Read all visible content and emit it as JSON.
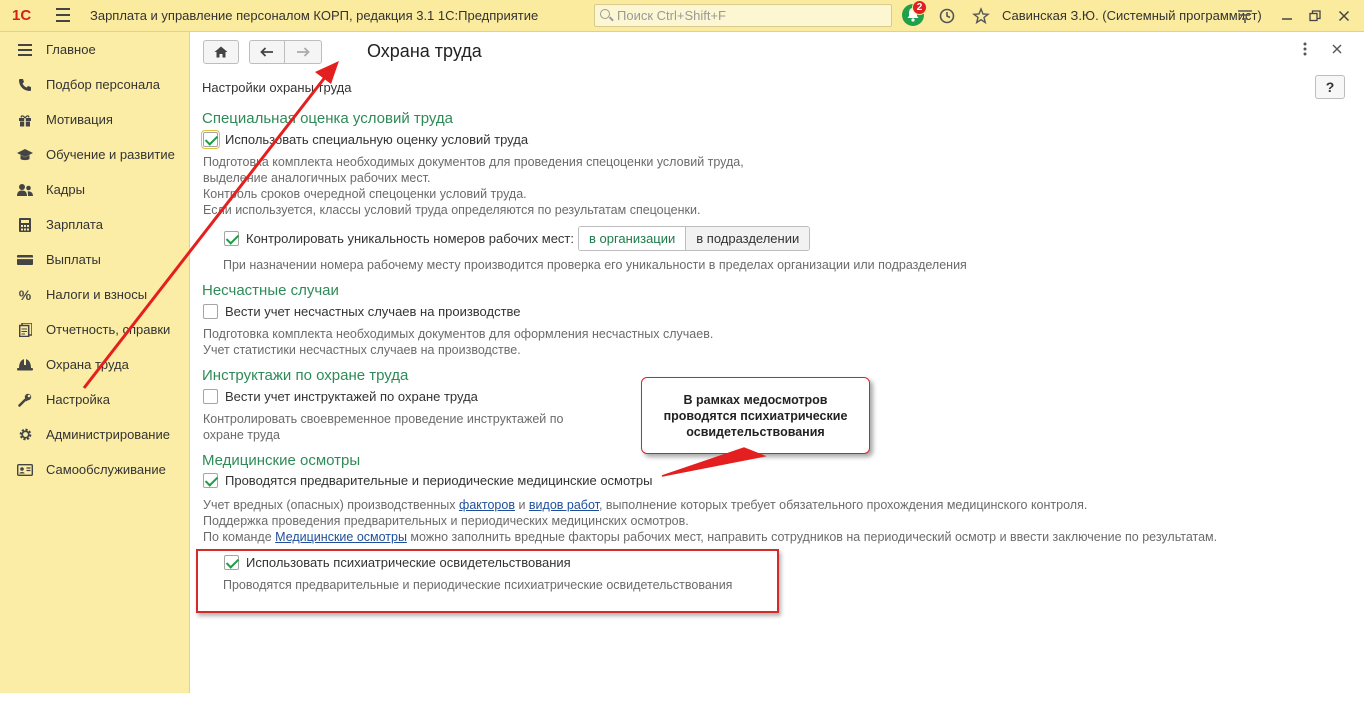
{
  "window": {
    "logo": "1С",
    "title": "Зарплата и управление персоналом КОРП, редакция 3.1 1С:Предприятие",
    "search_placeholder": "Поиск Ctrl+Shift+F",
    "notifications_count": "2",
    "user": "Савинская З.Ю. (Системный программист)"
  },
  "sidebar": {
    "items": [
      {
        "label": "Главное",
        "icon": "hamburger-icon"
      },
      {
        "label": "Подбор персонала",
        "icon": "phone-icon"
      },
      {
        "label": "Мотивация",
        "icon": "gift-icon"
      },
      {
        "label": "Обучение и развитие",
        "icon": "graduation-cap-icon"
      },
      {
        "label": "Кадры",
        "icon": "people-icon"
      },
      {
        "label": "Зарплата",
        "icon": "calculator-icon"
      },
      {
        "label": "Выплаты",
        "icon": "wallet-icon"
      },
      {
        "label": "Налоги и взносы",
        "icon": "percent-icon"
      },
      {
        "label": "Отчетность, справки",
        "icon": "report-icon"
      },
      {
        "label": "Охрана труда",
        "icon": "helmet-icon"
      },
      {
        "label": "Настройка",
        "icon": "wrench-icon"
      },
      {
        "label": "Администрирование",
        "icon": "gear-icon"
      },
      {
        "label": "Самообслуживание",
        "icon": "id-card-icon"
      }
    ]
  },
  "page": {
    "title": "Охрана труда",
    "subtitle": "Настройки охраны труда",
    "help": "?"
  },
  "sections": {
    "sout": {
      "heading": "Специальная оценка условий труда",
      "checkbox": "Использовать специальную оценку условий труда",
      "checked": true,
      "notes": [
        "Подготовка комплекта необходимых документов для проведения спецоценки условий труда,",
        "выделение аналогичных рабочих мест.",
        "Контроль сроков очередной спецоценки условий труда.",
        "Если используется, классы условий труда определяются по результатам спецоценки."
      ],
      "unique_checkbox": "Контролировать уникальность номеров рабочих мест:",
      "unique_checked": true,
      "scope_options": [
        "в организации",
        "в подразделении"
      ],
      "scope_selected": "в организации",
      "unique_note": "При назначении номера рабочему месту производится проверка его уникальности в пределах организации или подразделения"
    },
    "accidents": {
      "heading": "Несчастные случаи",
      "checkbox": "Вести учет несчастных случаев на производстве",
      "checked": false,
      "notes": [
        "Подготовка комплекта необходимых документов для оформления несчастных случаев.",
        "Учет статистики несчастных случаев на производстве."
      ]
    },
    "briefings": {
      "heading": "Инструктажи по охране труда",
      "checkbox": "Вести учет инструктажей по охране труда",
      "checked": false,
      "notes": [
        "Контролировать своевременное проведение инструктажей по",
        "охране труда"
      ]
    },
    "medical": {
      "heading": "Медицинские осмотры",
      "checkbox": "Проводятся предварительные и периодические медицинские осмотры",
      "checked": true,
      "note1_pre": "Учет вредных (опасных) производственных ",
      "note1_link1": "факторов",
      "note1_mid": " и ",
      "note1_link2": "видов работ",
      "note1_post": ", выполнение которых требует обязательного прохождения медицинского контроля.",
      "note2": "Поддержка проведения предварительных и периодических медицинских осмотров.",
      "note3_pre": "По команде ",
      "note3_link": "Медицинские осмотры",
      "note3_post": " можно заполнить вредные факторы рабочих мест, направить сотрудников на периодический осмотр и ввести заключение по результатам.",
      "psych_checkbox": "Использовать психиатрические освидетельствования",
      "psych_checked": true,
      "psych_note": "Проводятся предварительные и периодические психиатрические освидетельствования"
    }
  },
  "callout": {
    "lines": [
      "В рамках медосмотров",
      "проводятся психиатрические",
      "освидетельствования"
    ]
  },
  "colors": {
    "titlebar": "#fbeb9e",
    "sidebar": "#fbeda6",
    "section_heading": "#2e8b57",
    "annotation_red": "#d42a2a"
  }
}
